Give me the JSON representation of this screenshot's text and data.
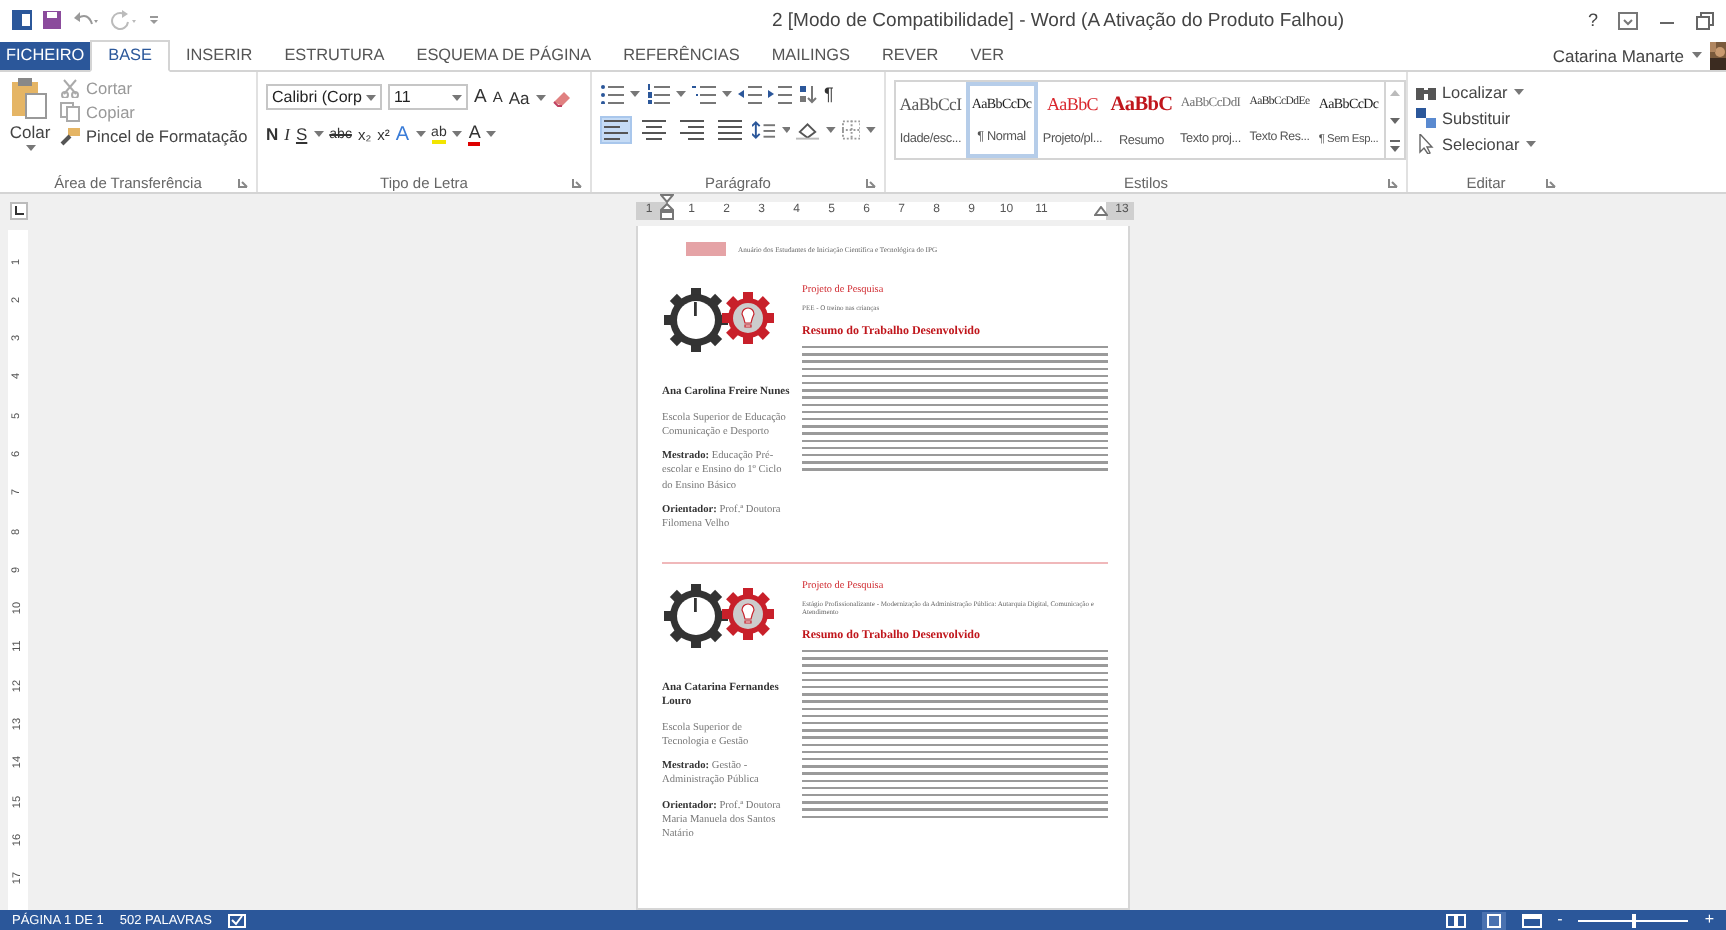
{
  "window": {
    "title": "2 [Modo de Compatibilidade] - Word (A Ativação do Produto Falhou)",
    "help": "?",
    "user": "Catarina Manarte"
  },
  "tabs": [
    {
      "label": "FICHEIRO",
      "kind": "file",
      "selected": false
    },
    {
      "label": "BASE",
      "kind": "tab",
      "selected": true
    },
    {
      "label": "INSERIR",
      "kind": "tab",
      "selected": false
    },
    {
      "label": "ESTRUTURA",
      "kind": "tab",
      "selected": false
    },
    {
      "label": "ESQUEMA DE PÁGINA",
      "kind": "tab",
      "selected": false
    },
    {
      "label": "REFERÊNCIAS",
      "kind": "tab",
      "selected": false
    },
    {
      "label": "MAILINGS",
      "kind": "tab",
      "selected": false
    },
    {
      "label": "REVER",
      "kind": "tab",
      "selected": false
    },
    {
      "label": "VER",
      "kind": "tab",
      "selected": false
    }
  ],
  "clipboard": {
    "paste": "Colar",
    "items": [
      {
        "label": "Cortar",
        "kind": "cut",
        "disabled": true
      },
      {
        "label": "Copiar",
        "kind": "copy",
        "disabled": true
      },
      {
        "label": "Pincel de Formatação",
        "kind": "brush",
        "disabled": false
      }
    ],
    "label": "Área de Transferência"
  },
  "font": {
    "family": "Calibri (Corp",
    "size": "11",
    "row1": [
      {
        "kind": "grow",
        "label": "A"
      },
      {
        "kind": "shrink",
        "label": "A"
      },
      {
        "kind": "case",
        "label": "Aa"
      }
    ],
    "row2": [
      {
        "kind": "bold",
        "label": "N"
      },
      {
        "kind": "italic",
        "label": "I"
      },
      {
        "kind": "underline",
        "label": "S"
      },
      {
        "kind": "strike",
        "label": "abc"
      },
      {
        "kind": "sub",
        "label": "x₂"
      },
      {
        "kind": "sup",
        "label": "x²"
      },
      {
        "kind": "effects",
        "label": "A"
      },
      {
        "kind": "highlight",
        "label": "ab"
      },
      {
        "kind": "color",
        "label": "A"
      }
    ],
    "label": "Tipo de Letra"
  },
  "paragraph": {
    "pilcrow": "¶",
    "align": [
      {
        "kind": "left",
        "selected": true
      },
      {
        "kind": "center",
        "selected": false
      },
      {
        "kind": "right",
        "selected": false
      },
      {
        "kind": "justify",
        "selected": false
      }
    ],
    "label": "Parágrafo"
  },
  "styles": {
    "items": [
      {
        "preview": "AaBbCcI",
        "name": "Idade/esc...",
        "color": "#595959",
        "bold": false,
        "selected": false
      },
      {
        "preview": "AaBbCcDc",
        "name": "¶ Normal",
        "color": "#222222",
        "bold": false,
        "selected": true
      },
      {
        "preview": "AaBbC",
        "name": "Projeto/pl...",
        "color": "#d9262c",
        "bold": false,
        "selected": false
      },
      {
        "preview": "AaBbC",
        "name": "Resumo",
        "color": "#c0161c",
        "bold": true,
        "selected": false
      },
      {
        "preview": "AaBbCcDdI",
        "name": "Texto proj...",
        "color": "#707070",
        "bold": false,
        "selected": false
      },
      {
        "preview": "AaBbCcDdEe",
        "name": "Texto Res...",
        "color": "#333333",
        "bold": false,
        "selected": false
      },
      {
        "preview": "AaBbCcDc",
        "name": "¶ Sem Esp...",
        "color": "#222222",
        "bold": false,
        "selected": false
      }
    ],
    "label": "Estilos"
  },
  "editing": {
    "items": [
      {
        "label": "Localizar",
        "kind": "find"
      },
      {
        "label": "Substituir",
        "kind": "replace"
      },
      {
        "label": "Selecionar",
        "kind": "select"
      }
    ],
    "label": "Editar"
  },
  "ruler": {
    "numbers": [
      "1",
      "1",
      "2",
      "3",
      "4",
      "5",
      "6",
      "7",
      "8",
      "9",
      "10",
      "11",
      "13"
    ],
    "vertical": [
      "1",
      "2",
      "3",
      "4",
      "5",
      "6",
      "7",
      "8",
      "9",
      "10",
      "11",
      "12",
      "13",
      "14",
      "15",
      "16",
      "17"
    ]
  },
  "document": {
    "header": "Anuário dos Estudantes de Iniciação Científica e Tecnológica do IPG",
    "entries": [
      {
        "label": "Projeto de Pesquisa",
        "project": "PEE - O treino nas crianças",
        "heading": "Resumo do Trabalho Desenvolvido",
        "author": "Ana Carolina Freire Nunes",
        "school": "Escola Superior de Educação Comunicação e Desporto",
        "degree": "**Mestrado:** Educação Pré-escolar e Ensino do 1º Ciclo do Ensino Básico",
        "advisor": "**Orientador:** Prof.ª Doutora Filomena Velho"
      },
      {
        "label": "Projeto de Pesquisa",
        "project": "Estágio Profissionalizante - Modernização da Administração Pública: Autarquia Digital, Comunicação e Atendimento",
        "heading": "Resumo do Trabalho Desenvolvido",
        "author": "Ana Catarina Fernandes Louro",
        "school": "Escola Superior de Tecnologia e Gestão",
        "degree": "**Mestrado:** Gestão - Administração Pública",
        "advisor": "**Orientador:** Prof.ª Doutora Maria Manuela dos Santos Natário"
      }
    ]
  },
  "status_bar": {
    "page": "PÁGINA 1 DE 1",
    "words": "502 PALAVRAS",
    "zoom": {
      "level": 0.5,
      "minus": "-",
      "plus": "+"
    }
  }
}
